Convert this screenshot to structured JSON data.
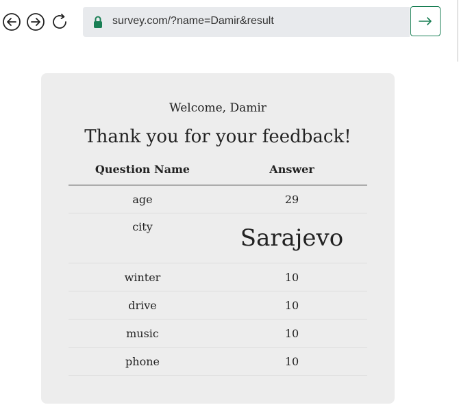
{
  "browser": {
    "back_icon": "arrow-left-circle-icon",
    "forward_icon": "arrow-right-circle-icon",
    "reload_icon": "reload-icon",
    "lock_icon": "lock-icon",
    "go_icon": "arrow-right-icon",
    "url": "survey.com/?name=Damir&result",
    "accent_color": "#1a7f55"
  },
  "page": {
    "welcome": "Welcome, Damir",
    "headline": "Thank you for your feedback!",
    "table": {
      "headers": [
        "Question Name",
        "Answer"
      ],
      "rows": [
        {
          "question": "age",
          "answer": "29"
        },
        {
          "question": "city",
          "answer": "Sarajevo"
        },
        {
          "question": "winter",
          "answer": "10"
        },
        {
          "question": "drive",
          "answer": "10"
        },
        {
          "question": "music",
          "answer": "10"
        },
        {
          "question": "phone",
          "answer": "10"
        }
      ]
    }
  }
}
